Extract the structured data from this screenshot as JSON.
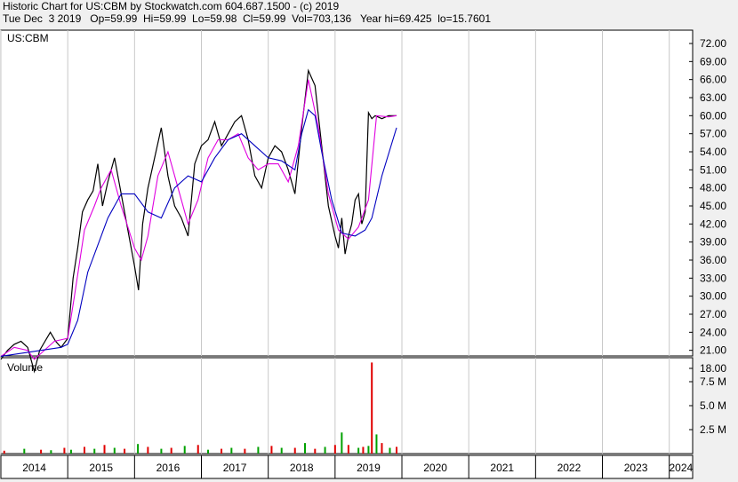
{
  "header": {
    "line1": "Historic Chart for US:CBM by Stockwatch.com 604.687.1500 - (c) 2019",
    "line2": "Tue Dec  3 2019   Op=59.99  Hi=59.99  Lo=59.98  Cl=59.99  Vol=703,136   Year hi=69.425  lo=15.7601"
  },
  "colors": {
    "background": "#ffffff",
    "frame": "#f0f0f0",
    "price": "#000000",
    "ma_short": "#e000e0",
    "ma_long": "#0000c0",
    "volume_up": "#00a000",
    "volume_down": "#e00000",
    "grid": "#c8c8c8"
  },
  "chart_data": [
    {
      "type": "line",
      "title": "US:CBM",
      "ylim": [
        15.76,
        74.0
      ],
      "y_ticks": [
        "72.00",
        "69.00",
        "66.00",
        "63.00",
        "60.00",
        "57.00",
        "54.00",
        "51.00",
        "48.00",
        "45.00",
        "42.00",
        "39.00",
        "36.00",
        "33.00",
        "30.00",
        "27.00",
        "24.00",
        "21.00",
        "18.00"
      ],
      "x_ticks": [
        "2014",
        "2015",
        "2016",
        "2017",
        "2018",
        "2019",
        "2020",
        "2021",
        "2022",
        "2023",
        "2024"
      ],
      "xlim": [
        2014.0,
        2024.35
      ],
      "series": [
        {
          "x": [
            2014.0,
            2014.1,
            2014.2,
            2014.3,
            2014.4,
            2014.5,
            2014.58,
            2014.66,
            2014.74,
            2014.82,
            2014.9,
            2015.0,
            2015.08,
            2015.15,
            2015.22,
            2015.3,
            2015.38,
            2015.45,
            2015.52,
            2015.6,
            2015.7,
            2015.8,
            2015.9,
            2016.0,
            2016.06,
            2016.12,
            2016.2,
            2016.3,
            2016.4,
            2016.5,
            2016.6,
            2016.7,
            2016.8,
            2016.9,
            2017.0,
            2017.1,
            2017.2,
            2017.3,
            2017.4,
            2017.5,
            2017.6,
            2017.7,
            2017.8,
            2017.9,
            2018.0,
            2018.1,
            2018.2,
            2018.3,
            2018.4,
            2018.5,
            2018.6,
            2018.7,
            2018.8,
            2018.9,
            2019.0,
            2019.05,
            2019.1,
            2019.15,
            2019.2,
            2019.25,
            2019.3,
            2019.35,
            2019.4,
            2019.45,
            2019.5,
            2019.55,
            2019.6,
            2019.7,
            2019.8,
            2019.92
          ],
          "values": [
            19.5,
            21.0,
            22.0,
            22.5,
            21.5,
            17.5,
            21.0,
            22.5,
            24.0,
            22.5,
            21.5,
            23.0,
            33.0,
            38.0,
            44.0,
            46.0,
            47.5,
            52.0,
            45.0,
            49.0,
            53.0,
            47.0,
            41.0,
            35.0,
            31.0,
            42.0,
            48.0,
            53.0,
            58.0,
            50.0,
            45.0,
            43.0,
            40.0,
            52.0,
            55.0,
            56.0,
            59.0,
            55.0,
            57.0,
            59.0,
            60.0,
            56.0,
            50.0,
            48.0,
            53.0,
            55.0,
            54.0,
            51.0,
            47.0,
            58.0,
            67.5,
            65.0,
            55.0,
            45.0,
            40.0,
            38.0,
            43.0,
            37.0,
            40.0,
            42.0,
            46.0,
            47.0,
            42.0,
            44.0,
            60.5,
            59.5,
            60.0,
            59.5,
            60.0,
            59.99
          ]
        },
        {
          "x": [
            2014.0,
            2014.2,
            2014.4,
            2014.5,
            2014.6,
            2014.8,
            2015.0,
            2015.1,
            2015.25,
            2015.4,
            2015.5,
            2015.65,
            2015.8,
            2016.0,
            2016.1,
            2016.2,
            2016.35,
            2016.5,
            2016.65,
            2016.8,
            2016.95,
            2017.1,
            2017.25,
            2017.4,
            2017.55,
            2017.7,
            2017.85,
            2018.0,
            2018.15,
            2018.3,
            2018.45,
            2018.6,
            2018.75,
            2018.9,
            2019.05,
            2019.2,
            2019.35,
            2019.5,
            2019.62,
            2019.8,
            2019.92
          ],
          "values": [
            20.0,
            21.5,
            21.0,
            19.5,
            20.5,
            22.5,
            23.0,
            30.0,
            41.0,
            45.0,
            48.0,
            51.0,
            45.0,
            38.0,
            36.0,
            40.0,
            50.0,
            54.0,
            48.0,
            42.0,
            46.0,
            53.0,
            56.0,
            56.0,
            57.0,
            53.0,
            51.0,
            52.0,
            52.0,
            49.0,
            55.0,
            66.0,
            58.0,
            47.0,
            41.0,
            39.5,
            41.5,
            46.0,
            60.0,
            59.8,
            60.0
          ]
        },
        {
          "x": [
            2014.0,
            2014.3,
            2014.6,
            2014.9,
            2015.0,
            2015.15,
            2015.3,
            2015.5,
            2015.6,
            2015.8,
            2016.0,
            2016.2,
            2016.4,
            2016.6,
            2016.8,
            2017.0,
            2017.2,
            2017.4,
            2017.6,
            2017.8,
            2018.0,
            2018.2,
            2018.4,
            2018.5,
            2018.6,
            2018.7,
            2018.8,
            2018.95,
            2019.1,
            2019.3,
            2019.45,
            2019.55,
            2019.7,
            2019.92
          ],
          "values": [
            20.0,
            20.5,
            21.0,
            21.5,
            22.0,
            26.0,
            34.0,
            40.0,
            43.0,
            47.0,
            47.0,
            44.0,
            43.0,
            48.0,
            50.0,
            49.0,
            53.0,
            56.0,
            57.0,
            55.0,
            53.0,
            52.5,
            51.0,
            57.0,
            61.0,
            60.0,
            54.0,
            46.0,
            40.5,
            40.0,
            41.0,
            43.0,
            50.0,
            58.0
          ]
        }
      ]
    },
    {
      "type": "bar",
      "title": "Volume",
      "y_ticks": [
        "7.5 M",
        "5.0 M",
        "2.5 M"
      ],
      "ylim": [
        0,
        10.0
      ],
      "x": [
        2014.05,
        2014.35,
        2014.6,
        2014.75,
        2014.95,
        2015.05,
        2015.25,
        2015.4,
        2015.55,
        2015.7,
        2015.85,
        2016.05,
        2016.2,
        2016.4,
        2016.55,
        2016.75,
        2016.95,
        2017.1,
        2017.3,
        2017.45,
        2017.65,
        2017.85,
        2018.05,
        2018.2,
        2018.4,
        2018.55,
        2018.7,
        2018.85,
        2019.0,
        2019.1,
        2019.2,
        2019.35,
        2019.42,
        2019.5,
        2019.55,
        2019.62,
        2019.7,
        2019.82,
        2019.92
      ],
      "values": [
        0.3,
        0.5,
        0.4,
        0.35,
        0.6,
        0.4,
        0.7,
        0.5,
        0.9,
        0.6,
        0.5,
        1.0,
        0.7,
        0.5,
        0.6,
        0.8,
        0.9,
        0.4,
        0.5,
        0.6,
        0.5,
        0.7,
        0.8,
        0.6,
        0.6,
        1.1,
        0.5,
        0.7,
        0.9,
        2.2,
        0.9,
        0.6,
        0.7,
        0.8,
        9.5,
        2.0,
        1.1,
        0.6,
        0.7
      ]
    }
  ]
}
